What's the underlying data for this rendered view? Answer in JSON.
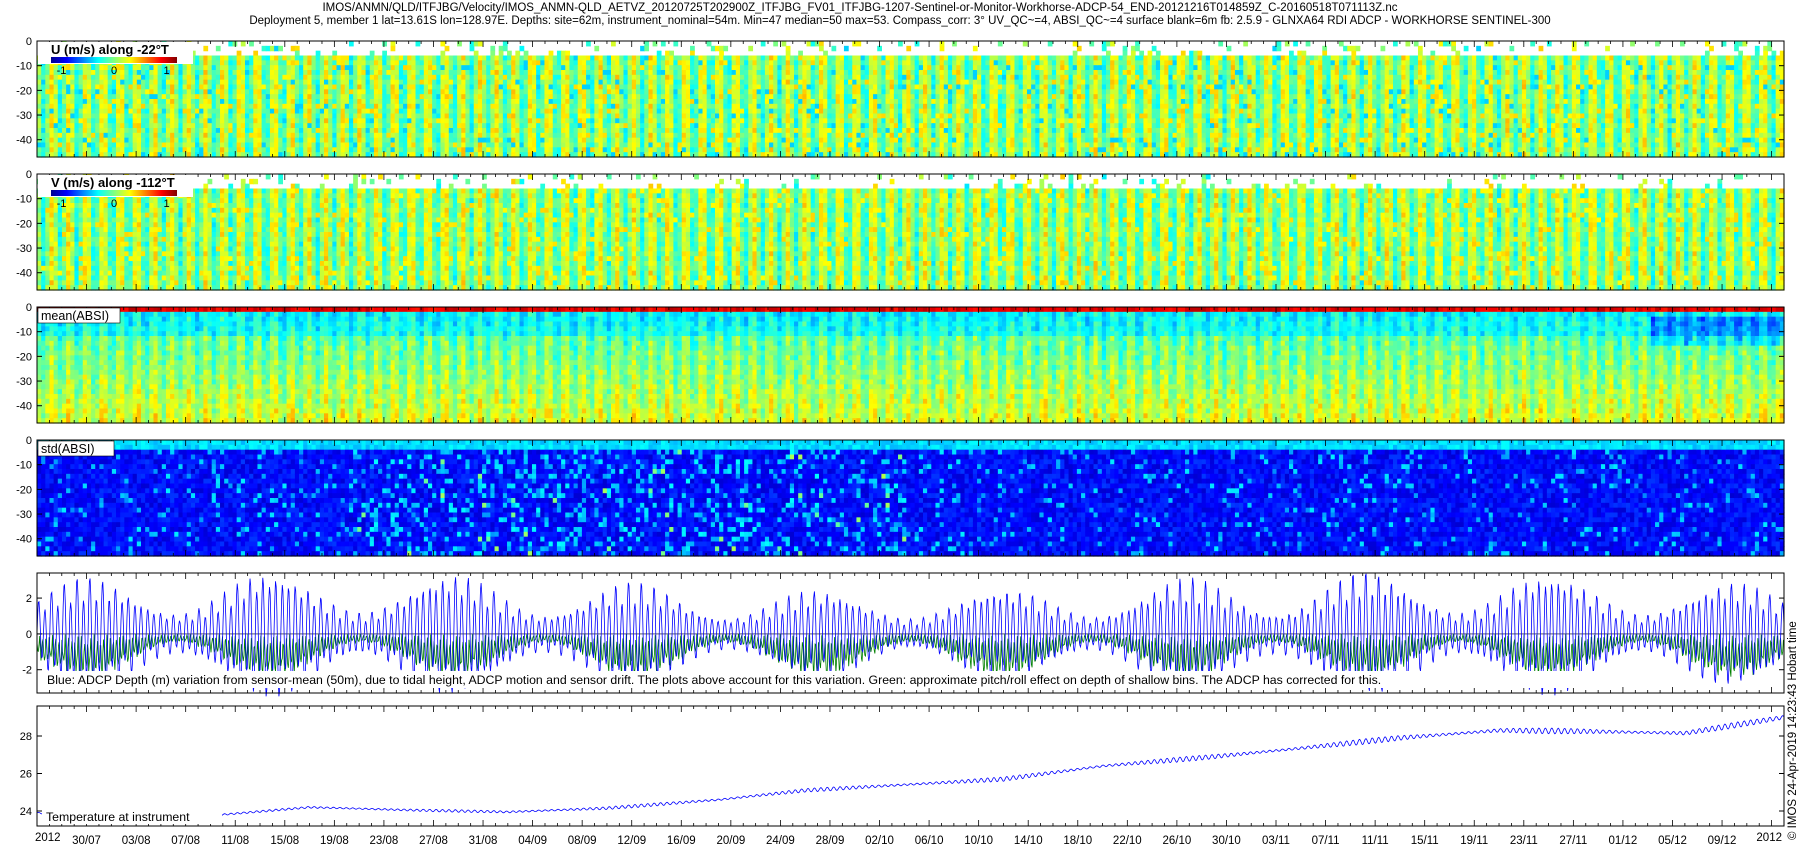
{
  "header": {
    "line1": "IMOS/ANMN/QLD/ITFJBG/Velocity/IMOS_ANMN-QLD_AETVZ_20120725T202900Z_ITFJBG_FV01_ITFJBG-1207-Sentinel-or-Monitor-Workhorse-ADCP-54_END-20121216T014859Z_C-20160518T071113Z.nc",
    "line2": "Deployment 5, member 1 lat=13.61S lon=128.97E. Depths: site=62m, instrument_nominal=54m. Min=47 median=50 max=53. Compass_corr: 3° UV_QC~=4, ABSI_QC~=4 surface blank=6m fb: 2.5.9 - GLNXA64 RDI ADCP - WORKHORSE SENTINEL-300"
  },
  "side_note": "© IMOS 24-Apr-2019 14:23:43 Hobart time",
  "colors": {
    "line_blue": "#0000ff",
    "line_green": "#008000",
    "axis": "#000000"
  },
  "chart_data": [
    {
      "type": "heatmap",
      "title": "U (m/s) along -22°T",
      "colorbar": {
        "ticks": [
          "-1",
          "0",
          "1"
        ],
        "range": [
          -1.2,
          1.2
        ],
        "colormap": "jet"
      },
      "ylim": [
        -47,
        0
      ],
      "yticks": [
        "0",
        "-10",
        "-20",
        "-30",
        "-40"
      ],
      "ytick_values": [
        0,
        -10,
        -20,
        -30,
        -40
      ],
      "surface_blank_m": 6,
      "dominant_value": 0.05,
      "character": "tidal stripes"
    },
    {
      "type": "heatmap",
      "title": "V (m/s) along -112°T",
      "colorbar": {
        "ticks": [
          "-1",
          "0",
          "1"
        ],
        "range": [
          -1.2,
          1.2
        ],
        "colormap": "jet"
      },
      "ylim": [
        -47,
        0
      ],
      "yticks": [
        "0",
        "-10",
        "-20",
        "-30",
        "-40"
      ],
      "ytick_values": [
        0,
        -10,
        -20,
        -30,
        -40
      ],
      "surface_blank_m": 6,
      "dominant_value": 0.05,
      "character": "tidal stripes"
    },
    {
      "type": "heatmap",
      "title": "mean(ABSI)",
      "ylim": [
        -47,
        0
      ],
      "yticks": [
        "0",
        "-10",
        "-20",
        "-30",
        "-40"
      ],
      "ytick_values": [
        0,
        -10,
        -20,
        -30,
        -40
      ],
      "colormap": "jet",
      "character": "red near surface, cyan mid-upper, green at depth"
    },
    {
      "type": "heatmap",
      "title": "std(ABSI)",
      "ylim": [
        -47,
        0
      ],
      "yticks": [
        "0",
        "-10",
        "-20",
        "-30",
        "-40"
      ],
      "ytick_values": [
        0,
        -10,
        -20,
        -30,
        -40
      ],
      "colormap": "jet",
      "character": "mostly dark blue"
    },
    {
      "type": "line",
      "caption": "Blue: ADCP Depth (m) variation from sensor-mean (50m), due to tidal height, ADCP motion and sensor drift. The plots above account for this variation. Green: approximate pitch/roll effect on depth of shallow bins. The ADCP has corrected for this.",
      "ylim": [
        -3.3,
        3.4
      ],
      "yticks": [
        "2",
        "0",
        "-2"
      ],
      "ytick_values": [
        2,
        0,
        -2
      ],
      "series": [
        {
          "color": "#0000ff",
          "spring_amplitude": 3.0,
          "neap_amplitude": 1.0
        },
        {
          "color": "#008000",
          "spring_amplitude": -2.6,
          "neap_amplitude": -0.5
        }
      ]
    },
    {
      "type": "line",
      "caption": "Temperature at instrument",
      "ylim": [
        23.2,
        29.6
      ],
      "yticks": [
        "28",
        "26",
        "24"
      ],
      "ytick_values": [
        28,
        26,
        24
      ],
      "series": [
        {
          "color": "#0000ff",
          "x_days": [
            0,
            3,
            8,
            14,
            22,
            30,
            38,
            46,
            55,
            62,
            70,
            78,
            86,
            95,
            102,
            110,
            118,
            125,
            133,
            141
          ],
          "values": [
            23.9,
            23.75,
            23.7,
            23.75,
            24.2,
            24.05,
            23.95,
            24.15,
            24.6,
            25.1,
            25.4,
            25.7,
            26.4,
            26.9,
            27.35,
            27.9,
            28.3,
            28.25,
            28.15,
            29.0
          ]
        }
      ]
    }
  ],
  "time_axis": {
    "start_day": 0,
    "end_day": 141,
    "year_left": "2012",
    "year_right": "2012",
    "dates": [
      "30/07",
      "03/08",
      "07/08",
      "11/08",
      "15/08",
      "19/08",
      "23/08",
      "27/08",
      "31/08",
      "04/09",
      "08/09",
      "12/09",
      "16/09",
      "20/09",
      "24/09",
      "28/09",
      "02/10",
      "06/10",
      "10/10",
      "14/10",
      "18/10",
      "22/10",
      "26/10",
      "30/10",
      "03/11",
      "07/11",
      "11/11",
      "15/11",
      "19/11",
      "23/11",
      "27/11",
      "01/12",
      "05/12",
      "09/12"
    ],
    "date_days": [
      4,
      8,
      12,
      16,
      20,
      24,
      28,
      32,
      36,
      40,
      44,
      48,
      52,
      56,
      60,
      64,
      68,
      72,
      76,
      80,
      84,
      88,
      92,
      96,
      100,
      104,
      108,
      112,
      116,
      120,
      124,
      128,
      132,
      136
    ]
  }
}
